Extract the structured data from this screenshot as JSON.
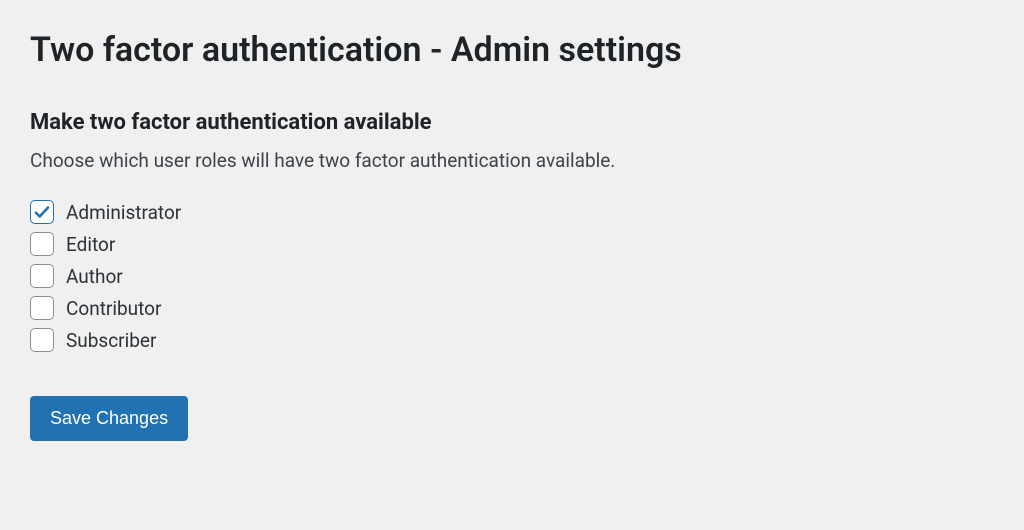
{
  "page": {
    "title": "Two factor authentication - Admin settings"
  },
  "section": {
    "heading": "Make two factor authentication available",
    "description": "Choose which user roles will have two factor authentication available."
  },
  "roles": [
    {
      "label": "Administrator",
      "checked": true
    },
    {
      "label": "Editor",
      "checked": false
    },
    {
      "label": "Author",
      "checked": false
    },
    {
      "label": "Contributor",
      "checked": false
    },
    {
      "label": "Subscriber",
      "checked": false
    }
  ],
  "buttons": {
    "save": "Save Changes"
  },
  "colors": {
    "accent": "#2271b1",
    "background": "#f0f0f1",
    "text": "#1d2327"
  }
}
